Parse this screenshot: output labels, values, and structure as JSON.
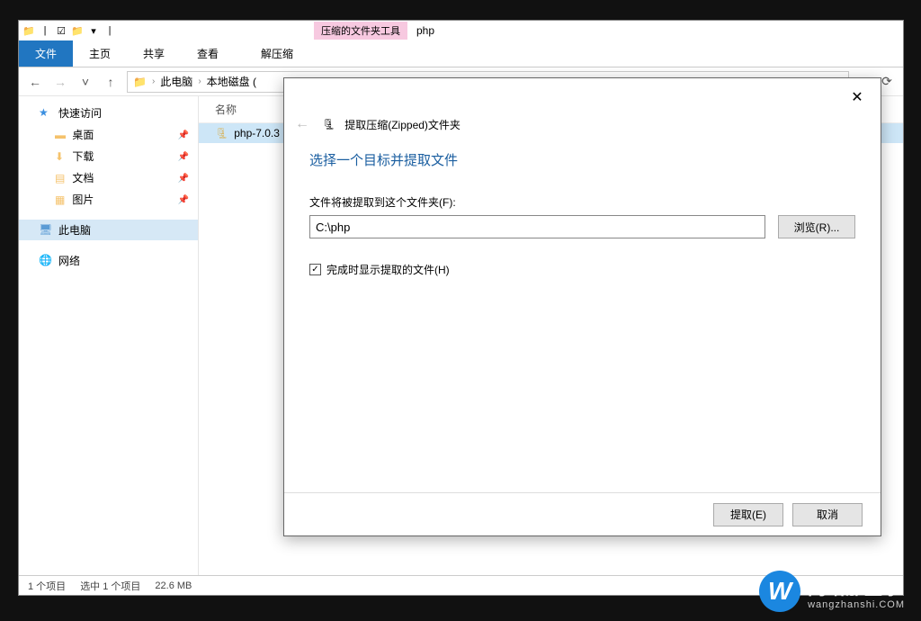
{
  "titlebar": {
    "tool_label": "压缩的文件夹工具",
    "window_title": "php"
  },
  "ribbon": {
    "file": "文件",
    "home": "主页",
    "share": "共享",
    "view": "查看",
    "extract": "解压缩"
  },
  "breadcrumb": {
    "this_pc": "此电脑",
    "drive": "本地磁盘 ("
  },
  "sidebar": {
    "quick_access": "快速访问",
    "desktop": "桌面",
    "downloads": "下载",
    "documents": "文档",
    "pictures": "图片",
    "this_pc": "此电脑",
    "network": "网络"
  },
  "filelist": {
    "header_name": "名称",
    "items": [
      {
        "name": "php-7.0.3"
      }
    ]
  },
  "statusbar": {
    "items": "1 个项目",
    "selected": "选中 1 个项目",
    "size": "22.6 MB"
  },
  "dialog": {
    "title": "提取压缩(Zipped)文件夹",
    "heading": "选择一个目标并提取文件",
    "field_label": "文件将被提取到这个文件夹(F):",
    "path_value": "C:\\php",
    "browse": "浏览(R)...",
    "checkbox_label": "完成时显示提取的文件(H)",
    "checkbox_checked": true,
    "extract_btn": "提取(E)",
    "cancel_btn": "取消"
  },
  "watermark": {
    "main": "网站那些事",
    "sub": "wangzhanshi.COM"
  }
}
